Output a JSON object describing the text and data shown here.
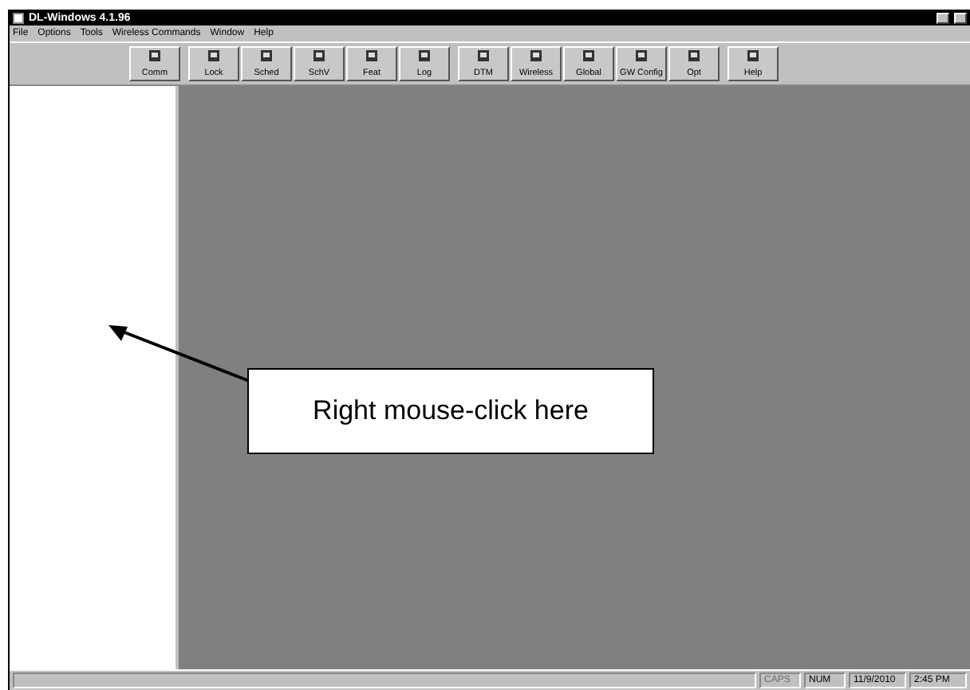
{
  "window": {
    "title": "DL-Windows 4.1.96"
  },
  "menu": [
    "File",
    "Options",
    "Tools",
    "Wireless Commands",
    "Window",
    "Help"
  ],
  "toolbar": [
    {
      "label": "Comm"
    },
    {
      "label": "Lock"
    },
    {
      "label": "Sched"
    },
    {
      "label": "SchV"
    },
    {
      "label": "Feat"
    },
    {
      "label": "Log"
    },
    {
      "label": "DTM"
    },
    {
      "label": "Wireless"
    },
    {
      "label": "Global"
    },
    {
      "label": "GW Config"
    },
    {
      "label": "Opt"
    },
    {
      "label": "Help"
    }
  ],
  "status_bar": [
    {
      "text": "CAPS",
      "disabled": true
    },
    {
      "text": "NUM",
      "disabled": false
    },
    {
      "text": "11/9/2010",
      "disabled": false
    },
    {
      "text": "2:45 PM",
      "disabled": false
    }
  ],
  "annotation": {
    "text": "Right mouse-click here"
  }
}
